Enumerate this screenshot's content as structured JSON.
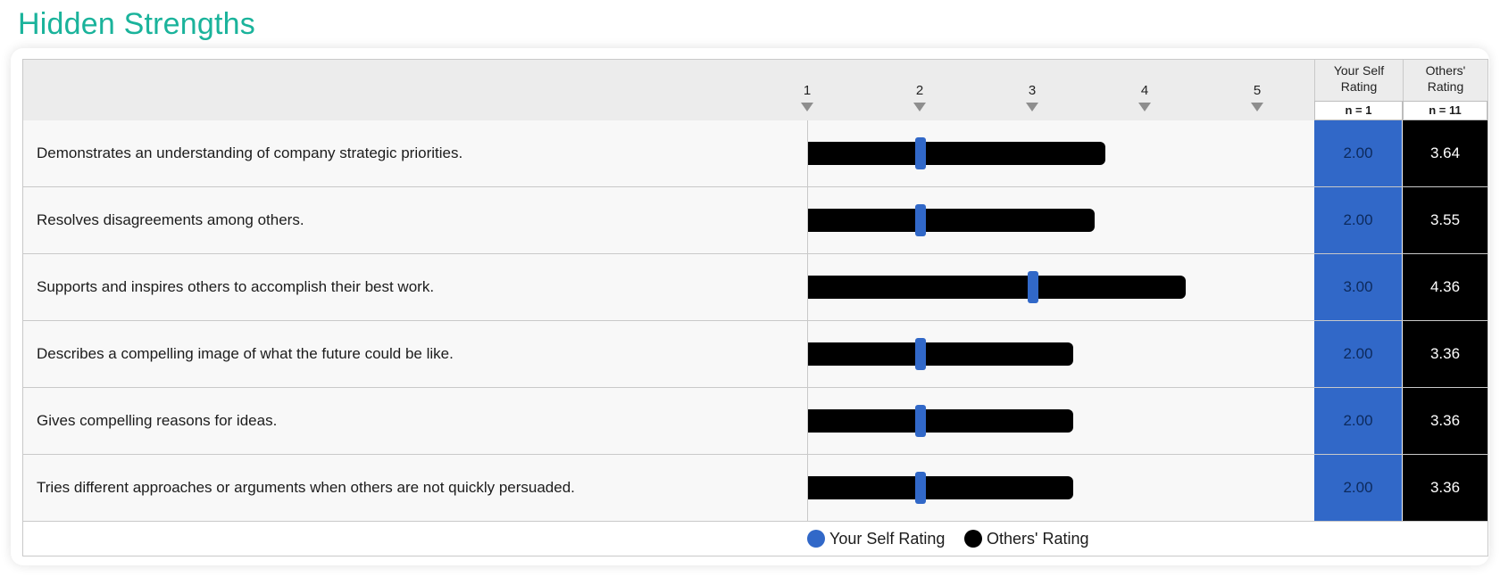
{
  "page": {
    "title": "Hidden Strengths"
  },
  "columns": {
    "self": {
      "label_line1": "Your Self",
      "label_line2": "Rating",
      "n": "n = 1"
    },
    "others": {
      "label_line1": "Others'",
      "label_line2": "Rating",
      "n": "n = 11"
    }
  },
  "colors": {
    "title": "#1ab39b",
    "self": "#3168c8",
    "others": "#000000"
  },
  "chart_data": {
    "type": "bar",
    "scale": [
      "1",
      "2",
      "3",
      "4",
      "5"
    ],
    "xlim": [
      1,
      5
    ],
    "categories": [
      "Demonstrates an understanding of company strategic priorities.",
      "Resolves disagreements among others.",
      "Supports and inspires others to accomplish their best work.",
      "Describes a compelling image of what the future could be like.",
      "Gives compelling reasons for ideas.",
      "Tries different approaches or arguments when others are not quickly persuaded."
    ],
    "series": [
      {
        "name": "Your Self Rating",
        "values": [
          "2.00",
          "2.00",
          "3.00",
          "2.00",
          "2.00",
          "2.00"
        ]
      },
      {
        "name": "Others' Rating",
        "values": [
          "3.64",
          "3.55",
          "4.36",
          "3.36",
          "3.36",
          "3.36"
        ]
      }
    ],
    "legend": {
      "position": "bottom",
      "entries": [
        "Your Self Rating",
        "Others' Rating"
      ]
    }
  }
}
